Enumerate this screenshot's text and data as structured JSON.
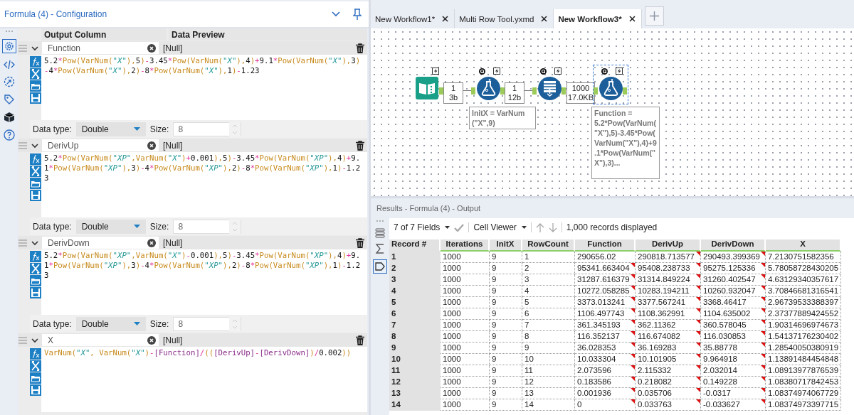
{
  "config": {
    "title": "Formula (4) - Configuration",
    "columns": [
      "Output Column",
      "Data Preview"
    ],
    "formulas": [
      {
        "output": "Function",
        "preview": "[Null]",
        "expanded": true,
        "expression": "5.2*Pow(VarNum(\"X\"),5)-3.45*Pow(VarNum(\"X\"),4)+9.1*Pow(VarNum(\"X\"),3)-4*Pow(VarNum(\"X\"),2)-8*Pow(VarNum(\"X\"),1)-1.23",
        "data_type_label": "Data type:",
        "data_type": "Double",
        "size_label": "Size:",
        "size": "8"
      },
      {
        "output": "DerivUp",
        "preview": "[Null]",
        "expanded": true,
        "expression": "5.2*Pow(VarNum(\"XP\",VarNum(\"X\")+0.001),5)-3.45*Pow(VarNum(\"XP\"),4)+9.1*Pow(VarNum(\"XP\"),3)-4*Pow(VarNum(\"XP\"),2)-8*Pow(VarNum(\"XP\"),1)-1.23",
        "data_type_label": "Data type:",
        "data_type": "Double",
        "size_label": "Size:",
        "size": "8"
      },
      {
        "output": "DerivDown",
        "preview": "[Null]",
        "expanded": true,
        "expression": "5.2*Pow(VarNum(\"XP\",VarNum(\"X\")-0.001),5)-3.45*Pow(VarNum(\"XP\"),4)+9.1*Pow(VarNum(\"XP\"),3)-4*Pow(VarNum(\"XP\"),2)-8*Pow(VarNum(\"XP\"),1)-1.23",
        "data_type_label": "Data type:",
        "data_type": "Double",
        "size_label": "Size:",
        "size": "8"
      },
      {
        "output": "X",
        "preview": "[Null]",
        "expanded": true,
        "expression": "VarNum(\"X\", VarNum(\"X\")-[Function]/(([DerivUp]-[DerivDown])/0.002))"
      }
    ]
  },
  "tabs": [
    {
      "label": "New Workflow1*",
      "selected": false
    },
    {
      "label": "Multi Row Tool.yxmd",
      "selected": false
    },
    {
      "label": "New Workflow3*",
      "selected": true
    }
  ],
  "canvas": {
    "nodes": [
      {
        "kind": "input",
        "selected": false
      },
      {
        "kind": "formula",
        "selected": false,
        "annotation": "InitX = VarNum (\"X\",9)"
      },
      {
        "kind": "multi_row",
        "selected": false
      },
      {
        "kind": "formula",
        "selected": true,
        "annotation": "Function = 5.2*Pow(VarNum(\"X\"),5)-3.45*Pow(VarNum(\"X\"),4)+9.1*Pow(VarNum(\"X\"),3)..."
      }
    ],
    "connections": [
      {
        "records": "1",
        "size": "3b"
      },
      {
        "records": "1",
        "size": "12b"
      },
      {
        "records": "1000",
        "size": "17.0KB"
      }
    ]
  },
  "results": {
    "title": "Results - Formula (4) - Output",
    "fields": "7 of 7 Fields",
    "viewer": "Cell Viewer",
    "status": "1,000 records displayed",
    "columns": [
      "Record #",
      "Iterations",
      "InitX",
      "RowCount",
      "Function",
      "DerivUp",
      "DerivDown",
      "X"
    ],
    "rows": [
      {
        "cells": [
          "1",
          "1000",
          "9",
          "1",
          "290656.02",
          "290818.713577",
          "290493.399369",
          "7.2130751582356"
        ],
        "flags": [
          false,
          false,
          false,
          false,
          false,
          true,
          true,
          false
        ]
      },
      {
        "cells": [
          "2",
          "1000",
          "9",
          "2",
          "95341.663404",
          "95408.238733",
          "95275.125336",
          "5.78058728430205"
        ],
        "flags": [
          false,
          false,
          false,
          false,
          true,
          true,
          true,
          false
        ]
      },
      {
        "cells": [
          "3",
          "1000",
          "9",
          "3",
          "31287.616379",
          "31314.849224",
          "31260.402547",
          "4.63129340357617"
        ],
        "flags": [
          false,
          false,
          false,
          false,
          true,
          true,
          true,
          false
        ]
      },
      {
        "cells": [
          "4",
          "1000",
          "9",
          "4",
          "10272.058285",
          "10283.194211",
          "10260.932047",
          "3.70846681316541"
        ],
        "flags": [
          false,
          false,
          false,
          false,
          true,
          true,
          true,
          false
        ]
      },
      {
        "cells": [
          "5",
          "1000",
          "9",
          "5",
          "3373.013241",
          "3377.567241",
          "3368.46417",
          "2.96739533388397"
        ],
        "flags": [
          false,
          false,
          false,
          false,
          true,
          true,
          true,
          false
        ]
      },
      {
        "cells": [
          "6",
          "1000",
          "9",
          "6",
          "1106.497743",
          "1108.362991",
          "1104.635002",
          "2.37377889424552"
        ],
        "flags": [
          false,
          false,
          false,
          false,
          true,
          true,
          true,
          false
        ]
      },
      {
        "cells": [
          "7",
          "1000",
          "9",
          "7",
          "361.345193",
          "362.11362",
          "360.578045",
          "1.90314696974673"
        ],
        "flags": [
          false,
          false,
          false,
          false,
          true,
          true,
          true,
          false
        ]
      },
      {
        "cells": [
          "8",
          "1000",
          "9",
          "8",
          "116.352137",
          "116.674082",
          "116.030853",
          "1.54137176230402"
        ],
        "flags": [
          false,
          false,
          false,
          false,
          true,
          true,
          true,
          false
        ]
      },
      {
        "cells": [
          "9",
          "1000",
          "9",
          "9",
          "36.028353",
          "36.169283",
          "35.88778",
          "1.28540050380919"
        ],
        "flags": [
          false,
          false,
          false,
          false,
          true,
          true,
          true,
          false
        ]
      },
      {
        "cells": [
          "10",
          "1000",
          "9",
          "10",
          "10.033304",
          "10.101905",
          "9.964918",
          "1.13891484454848"
        ],
        "flags": [
          false,
          false,
          false,
          false,
          true,
          true,
          true,
          false
        ]
      },
      {
        "cells": [
          "11",
          "1000",
          "9",
          "11",
          "2.073596",
          "2.115332",
          "2.032014",
          "1.08913977876539"
        ],
        "flags": [
          false,
          false,
          false,
          false,
          true,
          true,
          true,
          false
        ]
      },
      {
        "cells": [
          "12",
          "1000",
          "9",
          "12",
          "0.183586",
          "0.218082",
          "0.149228",
          "1.08380717842453"
        ],
        "flags": [
          false,
          false,
          false,
          false,
          true,
          true,
          true,
          false
        ]
      },
      {
        "cells": [
          "13",
          "1000",
          "9",
          "13",
          "0.001936",
          "0.035706",
          "-0.0317",
          "1.08374974067729"
        ],
        "flags": [
          false,
          false,
          false,
          false,
          true,
          true,
          true,
          false
        ]
      },
      {
        "cells": [
          "14",
          "1000",
          "9",
          "14",
          "0",
          "0.033763",
          "-0.033627",
          "1.08374973397715"
        ],
        "flags": [
          false,
          false,
          false,
          false,
          true,
          true,
          true,
          false
        ]
      }
    ]
  }
}
